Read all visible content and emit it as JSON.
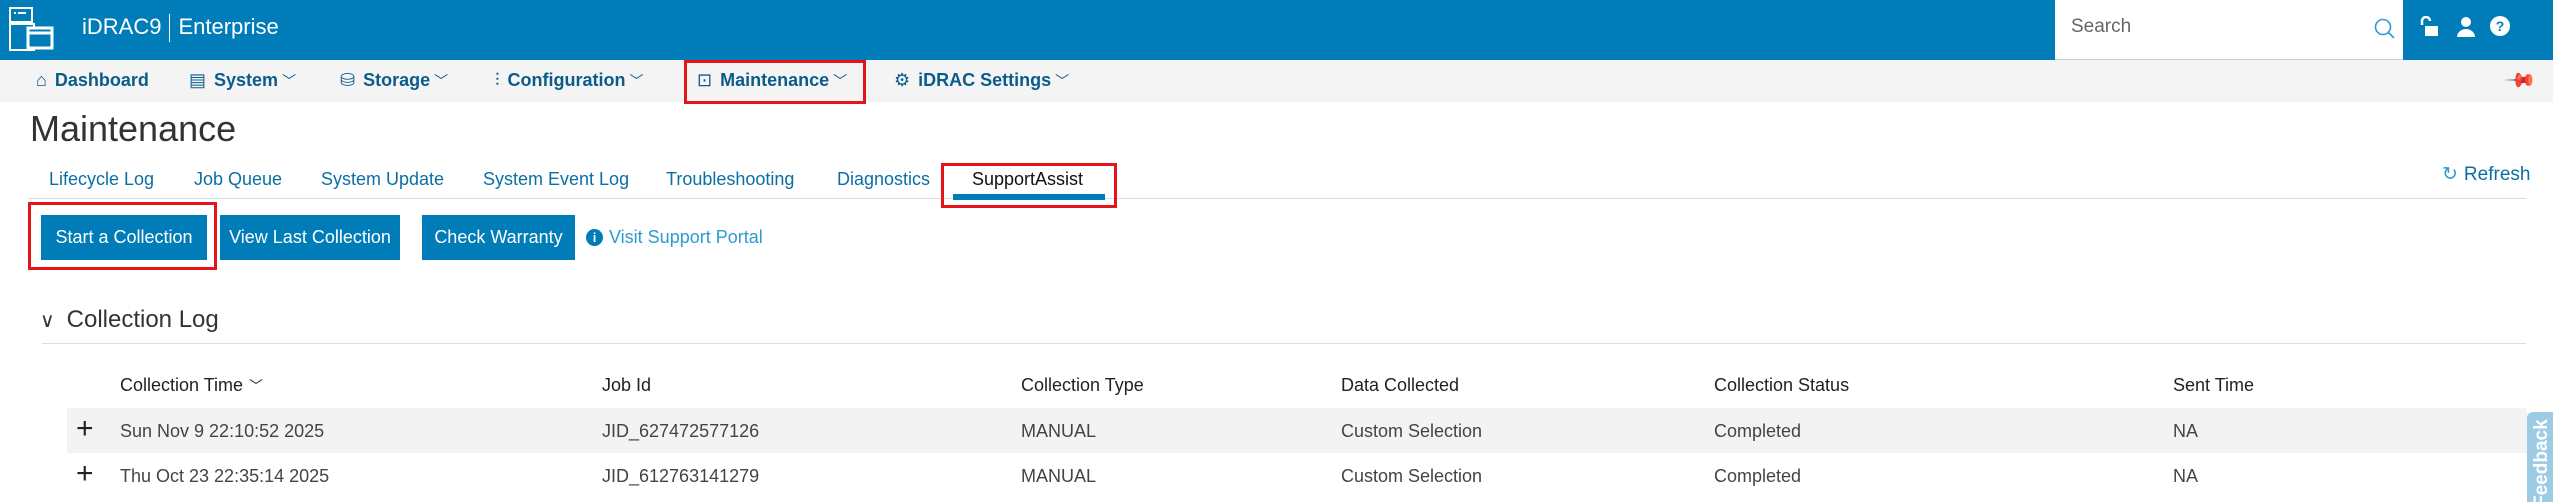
{
  "header": {
    "brand": "iDRAC9",
    "edition": "Enterprise",
    "search_placeholder": "Search"
  },
  "nav": {
    "items": [
      {
        "label": "Dashboard",
        "icon": "home-icon"
      },
      {
        "label": "System",
        "icon": "server-icon"
      },
      {
        "label": "Storage",
        "icon": "database-icon"
      },
      {
        "label": "Configuration",
        "icon": "sliders-icon"
      },
      {
        "label": "Maintenance",
        "icon": "monitor-icon"
      },
      {
        "label": "iDRAC Settings",
        "icon": "gears-icon"
      }
    ]
  },
  "page": {
    "title": "Maintenance",
    "refresh": "Refresh"
  },
  "tabs": [
    "Lifecycle Log",
    "Job Queue",
    "System Update",
    "System Event Log",
    "Troubleshooting",
    "Diagnostics",
    "SupportAssist"
  ],
  "actions": {
    "start": "Start a Collection",
    "view_last": "View Last Collection",
    "warranty": "Check Warranty",
    "visit": "Visit Support Portal"
  },
  "collection_log": {
    "title": "Collection Log",
    "columns": [
      "Collection Time",
      "Job Id",
      "Collection Type",
      "Data Collected",
      "Collection Status",
      "Sent Time"
    ],
    "rows": [
      [
        "Sun Nov 9 22:10:52 2025",
        "JID_627472577126",
        "MANUAL",
        "Custom Selection",
        "Completed",
        "NA"
      ],
      [
        "Thu Oct 23 22:35:14 2025",
        "JID_612763141279",
        "MANUAL",
        "Custom Selection",
        "Completed",
        "NA"
      ]
    ]
  },
  "feedback": "Feedback",
  "colors": {
    "brand": "#007db8",
    "highlight": "#e3151a"
  }
}
